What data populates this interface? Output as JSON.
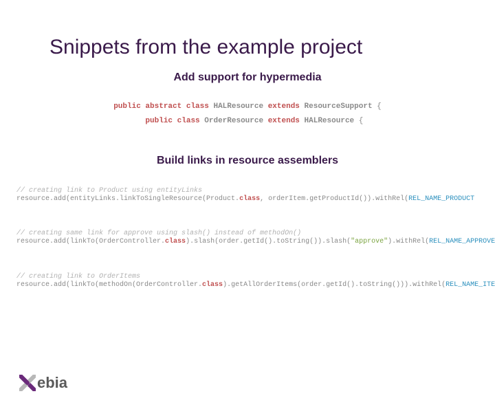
{
  "title": "Snippets from the example project",
  "section1": {
    "heading": "Add support for hypermedia",
    "line1": {
      "kw1": "public",
      "kw2": "abstract",
      "kw3": "class",
      "cls1": "HALResource",
      "kw4": "extends",
      "cls2": "ResourceSupport",
      "brace": "{"
    },
    "line2": {
      "kw1": "public",
      "kw3": "class",
      "cls1": "OrderResource",
      "kw4": "extends",
      "cls2": "HALResource",
      "brace": "{"
    }
  },
  "section2": {
    "heading": "Build links in resource assemblers",
    "block1": {
      "comment": "// creating link to Product using entityLinks",
      "p1": "resource.add(entityLinks.linkToSingleResource(Product.",
      "kw": "class",
      "p2": ", orderItem.getProductId()).withRel(",
      "const": "REL_NAME_PRODUCT",
      "tail": ""
    },
    "block2": {
      "comment": "// creating same link for approve using slash() instead of methodOn()",
      "p1": "resource.add(linkTo(OrderController.",
      "kw": "class",
      "p2": ").slash(order.getId().toString()).slash(",
      "str": "\"approve\"",
      "p3": ").withRel(",
      "const": "REL_NAME_APPROVE",
      "p4": "));"
    },
    "block3": {
      "comment": "// creating link to OrderItems",
      "p1": "resource.add(linkTo(methodOn(OrderController.",
      "kw": "class",
      "p2": ").getAllOrderItems(order.getId().toString())).withRel(",
      "const": "REL_NAME_ITEMS",
      "p3": "));"
    }
  },
  "logo": "ebia"
}
